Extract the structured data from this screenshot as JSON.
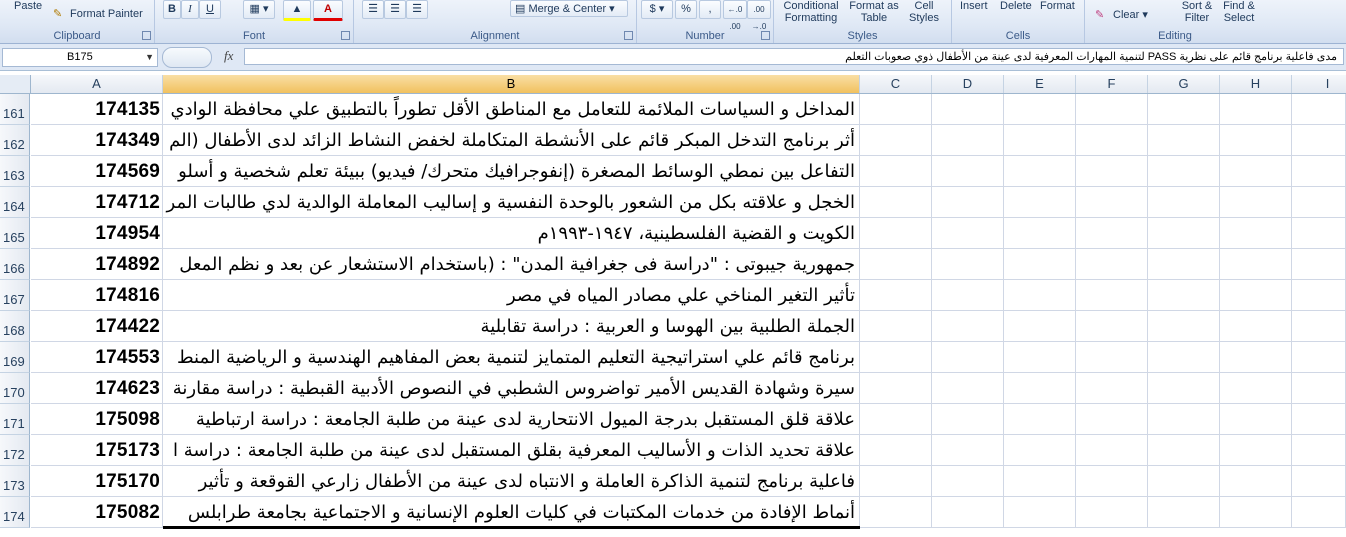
{
  "ribbon": {
    "clipboard": {
      "paste": "Paste",
      "format_painter": "Format Painter",
      "label": "Clipboard"
    },
    "font": {
      "bold": "B",
      "italic": "I",
      "underline": "U",
      "label": "Font"
    },
    "alignment": {
      "merge_center": "Merge & Center",
      "label": "Alignment"
    },
    "number": {
      "percent": "%",
      "comma": ",",
      "inc_decimal": "←.0 .00",
      "dec_decimal": ".00 →.0",
      "label": "Number"
    },
    "styles": {
      "conditional_formatting": "Conditional Formatting",
      "format_as_table": "Format as Table",
      "cell_styles": "Cell Styles",
      "label": "Styles"
    },
    "cells": {
      "insert": "Insert",
      "delete": "Delete",
      "format": "Format",
      "label": "Cells"
    },
    "editing": {
      "clear": "Clear",
      "sort_filter": "Sort & Filter",
      "find_select": "Find & Select",
      "label": "Editing"
    }
  },
  "formula_bar": {
    "name_box": "B175",
    "fx": "fx",
    "content": "مدى فاعلية برنامج قائم على نظرية PASS لتنمية المهارات المعرفية لدى عينة من الأطفال ذوي صعوبات التعلم"
  },
  "columns": [
    "A",
    "B",
    "C",
    "D",
    "E",
    "F",
    "G",
    "H",
    "I"
  ],
  "rows": [
    {
      "num": "161",
      "a": "174135",
      "b": "المداخل و السياسات الملائمة للتعامل مع المناطق الأقل تطوراً بالتطبيق علي محافظة الوادي"
    },
    {
      "num": "162",
      "a": "174349",
      "b": "أثر برنامج التدخل المبكر قائم على الأنشطة المتكاملة لخفض النشاط الزائد لدى الأطفال (الم"
    },
    {
      "num": "163",
      "a": "174569",
      "b": "التفاعل بين نمطي الوسائط المصغرة (إنفوجرافيك متحرك/ فيديو) ببيئة تعلم شخصية و أسلو"
    },
    {
      "num": "164",
      "a": "174712",
      "b": "الخجل و علاقته بكل من الشعور بالوحدة النفسية و إساليب المعاملة الوالدية لدي طالبات المر"
    },
    {
      "num": "165",
      "a": "174954",
      "b": "الكويت و القضية الفلسطينية، ١٩٤٧-١٩٩٣م"
    },
    {
      "num": "166",
      "a": "174892",
      "b": "جمهورية جيبوتى : \"دراسة فى جغرافية المدن\" : (باستخدام الاستشعار عن بعد و نظم المعل"
    },
    {
      "num": "167",
      "a": "174816",
      "b": "تأثير التغير المناخي علي مصادر المياه في مصر"
    },
    {
      "num": "168",
      "a": "174422",
      "b": "الجملة الطلبية بين الهوسا و العربية : دراسة تقابلية"
    },
    {
      "num": "169",
      "a": "174553",
      "b": "برنامج قائم علي استراتيجية التعليم المتمايز لتنمية بعض المفاهيم الهندسية و الرياضية المنط"
    },
    {
      "num": "170",
      "a": "174623",
      "b": "سيرة وشهادة القديس الأمير تواضروس الشطبي في النصوص الأدبية القبطية : دراسة مقارنة"
    },
    {
      "num": "171",
      "a": "175098",
      "b": "علاقة قلق المستقبل بدرجة الميول الانتحارية لدى عينة من طلبة الجامعة : دراسة ارتباطية"
    },
    {
      "num": "172",
      "a": "175173",
      "b": "علاقة تحديد الذات و الأساليب المعرفية بقلق المستقبل لدى عينة من طلبة الجامعة : دراسة ا"
    },
    {
      "num": "173",
      "a": "175170",
      "b": "فاعلية برنامج لتنمية الذاكرة العاملة و الانتباه لدى عينة من الأطفال زارعي القوقعة و تأثير"
    },
    {
      "num": "174",
      "a": "175082",
      "b": "أنماط الإفادة من خدمات المكتبات في كليات العلوم الإنسانية و الاجتماعية بجامعة طرابلس"
    }
  ]
}
